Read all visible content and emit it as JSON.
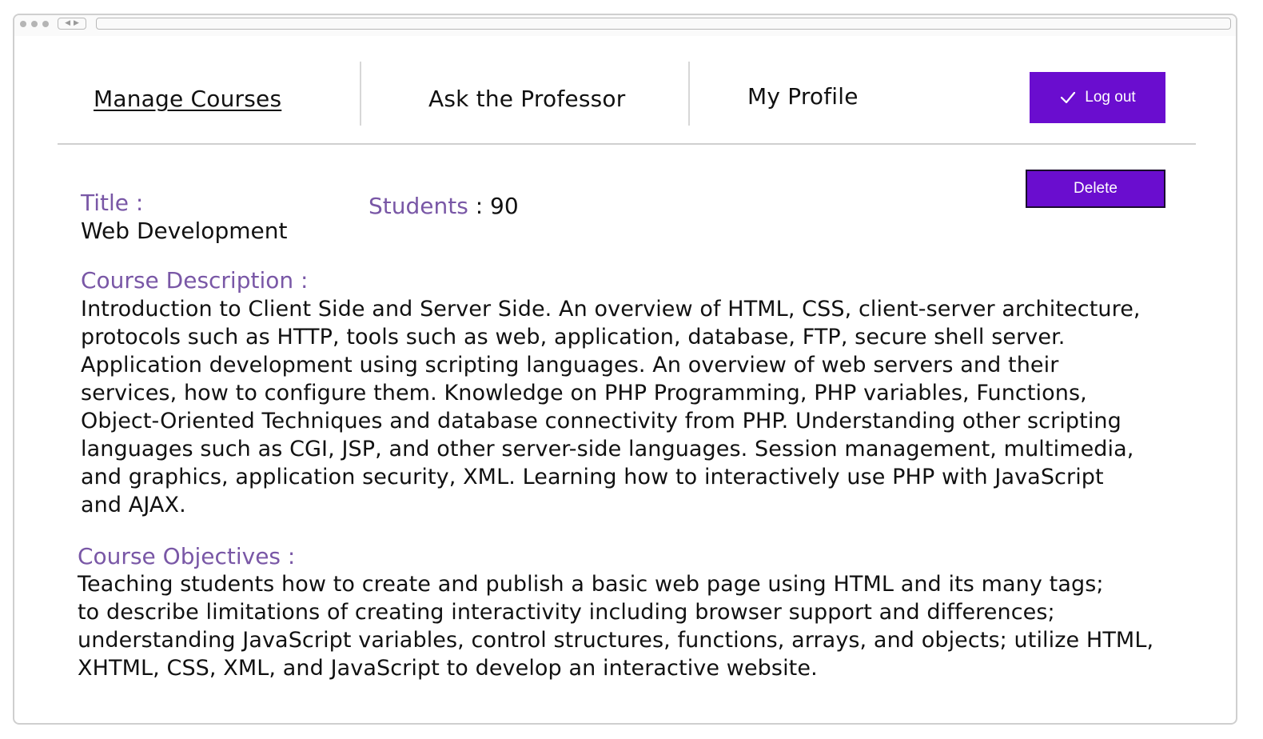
{
  "nav": {
    "manage_courses": "Manage Courses",
    "ask_professor": "Ask the Professor",
    "my_profile": "My Profile",
    "logout_label": "Log out",
    "logout_icon": "check-icon"
  },
  "course": {
    "delete_label": "Delete",
    "title_label": "Title :",
    "title_value": "Web Development",
    "students_label": "Students",
    "students_sep": " : ",
    "students_value": "90",
    "description_label": "Course Description :",
    "description_text": "Introduction to Client Side and Server Side. An overview of HTML, CSS, client-server architecture,\nprotocols such as HTTP, tools such as web, application, database, FTP, secure shell server.\nApplication development using scripting languages. An overview of web servers and their\nservices, how to configure them. Knowledge on PHP Programming, PHP variables, Functions,\nObject-Oriented Techniques and database connectivity from PHP. Understanding other scripting\nlanguages such as CGI, JSP, and other server-side languages. Session management, multimedia,\nand graphics, application security, XML. Learning how to interactively use PHP with JavaScript\nand AJAX.",
    "objectives_label": "Course Objectives :",
    "objectives_text": "Teaching students how to create and publish a basic web page using HTML and its many tags;\nto describe limitations of creating interactivity including browser support and differences;\nunderstanding JavaScript variables, control structures, functions, arrays, and objects; utilize HTML,\n XHTML, CSS, XML, and JavaScript to develop an interactive website."
  },
  "colors": {
    "accent": "#6a0dcf",
    "label": "#7957a6"
  }
}
